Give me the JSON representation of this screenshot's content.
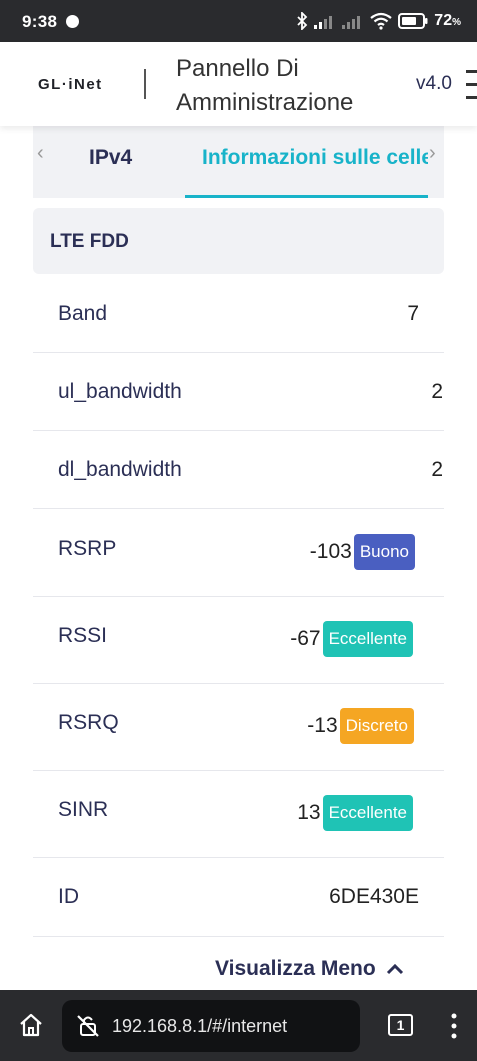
{
  "status_bar": {
    "time": "9:38",
    "battery": "72",
    "battery_unit": "%"
  },
  "header": {
    "logo": "GL·iNet",
    "title": "Pannello Di Amministrazione",
    "version": "v4.0"
  },
  "tabs": [
    {
      "label": "IPv4",
      "active": false
    },
    {
      "label": "Informazioni sulle celle",
      "active": true
    }
  ],
  "section": {
    "title": "LTE FDD"
  },
  "rows": [
    {
      "label": "Band",
      "value": "7"
    },
    {
      "label": "ul_bandwidth",
      "value": "2"
    },
    {
      "label": "dl_bandwidth",
      "value": "2"
    },
    {
      "label": "RSRP",
      "value": "-103",
      "badge": "Buono",
      "badge_color": "#4a5fc1"
    },
    {
      "label": "RSSI",
      "value": "-67",
      "badge": "Eccellente",
      "badge_color": "#1fc3b5"
    },
    {
      "label": "RSRQ",
      "value": "-13",
      "badge": "Discreto",
      "badge_color": "#f5a623"
    },
    {
      "label": "SINR",
      "value": "13",
      "badge": "Eccellente",
      "badge_color": "#1fc3b5"
    },
    {
      "label": "ID",
      "value": "6DE430E"
    }
  ],
  "show_less": {
    "label": "Visualizza Meno"
  },
  "browser": {
    "url": "192.168.8.1/#/internet",
    "tab_count": "1"
  },
  "colors": {
    "accent": "#18b3c9",
    "text": "#2b2f55",
    "panel_bg": "#f1f2f5",
    "badge_good": "#4a5fc1",
    "badge_excellent": "#1fc3b5",
    "badge_fair": "#f5a623"
  }
}
